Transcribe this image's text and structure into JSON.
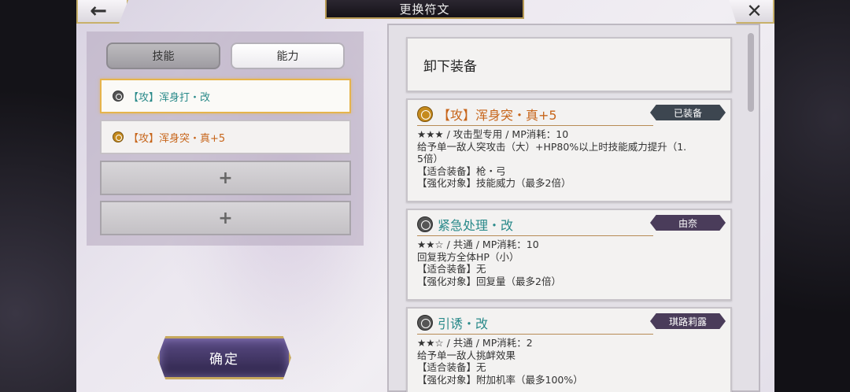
{
  "header": {
    "title": "更换符文",
    "back_icon": "←",
    "close_icon": "✕"
  },
  "tabs": [
    {
      "label": "技能",
      "selected": true
    },
    {
      "label": "能力",
      "selected": false
    }
  ],
  "slots": [
    {
      "label": "【攻】浑身打・改",
      "icon": "rune-gray-icon",
      "selected": true
    },
    {
      "label": "【攻】浑身突・真+5",
      "icon": "rune-gold-icon",
      "selected": false
    },
    {
      "label": "+",
      "empty": true
    },
    {
      "label": "+",
      "empty": true
    }
  ],
  "confirm_label": "确定",
  "unequip_label": "卸下装备",
  "cards": [
    {
      "title": "【攻】浑身突・真+5",
      "tag": "已装备",
      "line1": "★★★ / 攻击型专用 / MP消耗：10",
      "line2": "给予单一敌人突攻击（大）+HP80%以上时技能威力提升（1.",
      "line3": "5倍）",
      "line4": "【适合装备】枪・弓",
      "line5": "【强化对象】技能威力（最多2倍）"
    },
    {
      "title": "紧急处理・改",
      "tag": "由奈",
      "line1": "★★☆ / 共通 / MP消耗：10",
      "line2": "回复我方全体HP（小）",
      "line3": "【适合装备】无",
      "line4": "【强化对象】回复量（最多2倍）"
    },
    {
      "title": "引诱・改",
      "tag": "琪路莉露",
      "line1": "★★☆ / 共通 / MP消耗：2",
      "line2": "给予单一敌人挑衅效果",
      "line3": "【适合装备】无",
      "line4": "【强化对象】附加机率（最多100%）"
    }
  ],
  "colors": {
    "accent_gold": "#c7a95e",
    "attack_orange": "#c7651a",
    "skill_teal": "#2a8a8a"
  }
}
